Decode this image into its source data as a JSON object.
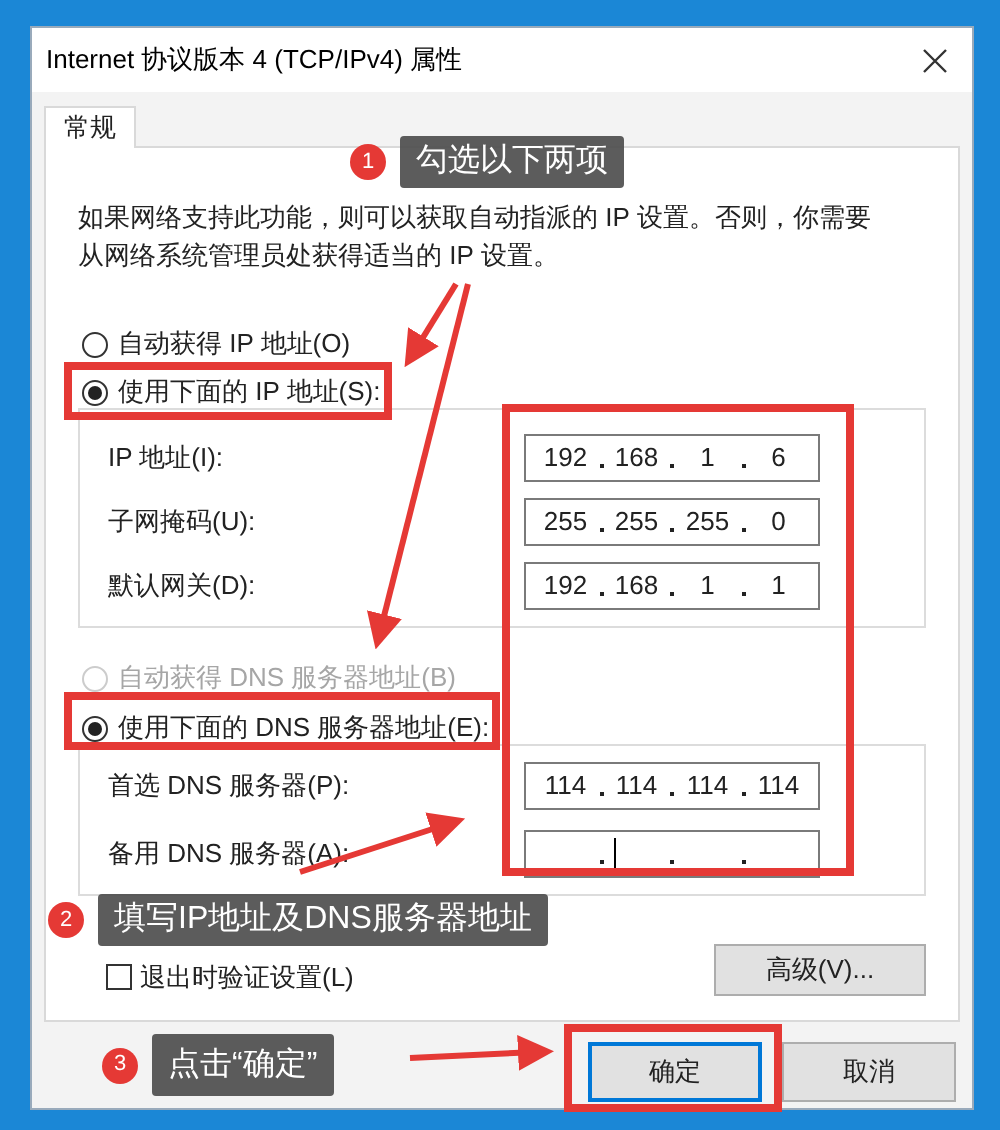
{
  "window": {
    "title": "Internet 协议版本 4 (TCP/IPv4) 属性"
  },
  "tabs": [
    {
      "label": "常规",
      "selected": true
    }
  ],
  "description": "如果网络支持此功能，则可以获取自动指派的 IP 设置。否则，你需要从网络系统管理员处获得适当的 IP 设置。",
  "ip_options": [
    {
      "label": "自动获得 IP 地址(O)",
      "selected": false,
      "disabled": false
    },
    {
      "label": "使用下面的 IP 地址(S):",
      "selected": true,
      "disabled": false
    }
  ],
  "ip_fields": [
    {
      "label": "IP 地址(I):",
      "octets": [
        "192",
        "168",
        "1",
        "6"
      ],
      "focused": false
    },
    {
      "label": "子网掩码(U):",
      "octets": [
        "255",
        "255",
        "255",
        "0"
      ],
      "focused": false
    },
    {
      "label": "默认网关(D):",
      "octets": [
        "192",
        "168",
        "1",
        "1"
      ],
      "focused": false
    }
  ],
  "dns_options": [
    {
      "label": "自动获得 DNS 服务器地址(B)",
      "selected": false,
      "disabled": true
    },
    {
      "label": "使用下面的 DNS 服务器地址(E):",
      "selected": true,
      "disabled": false
    }
  ],
  "dns_fields": [
    {
      "label": "首选 DNS 服务器(P):",
      "octets": [
        "114",
        "114",
        "114",
        "114"
      ],
      "focused": false
    },
    {
      "label": "备用 DNS 服务器(A):",
      "focused": true
    }
  ],
  "validate_checkbox": {
    "label": "退出时验证设置(L)",
    "checked": false
  },
  "advanced_button": "高级(V)...",
  "footer_buttons": [
    {
      "label": "确定",
      "default": true
    },
    {
      "label": "取消",
      "default": false
    }
  ],
  "annotations": [
    {
      "number": "1",
      "text": "勾选以下两项"
    },
    {
      "number": "2",
      "text": "填写IP地址及DNS服务器地址"
    },
    {
      "number": "3",
      "text": "点击“确定”"
    }
  ]
}
